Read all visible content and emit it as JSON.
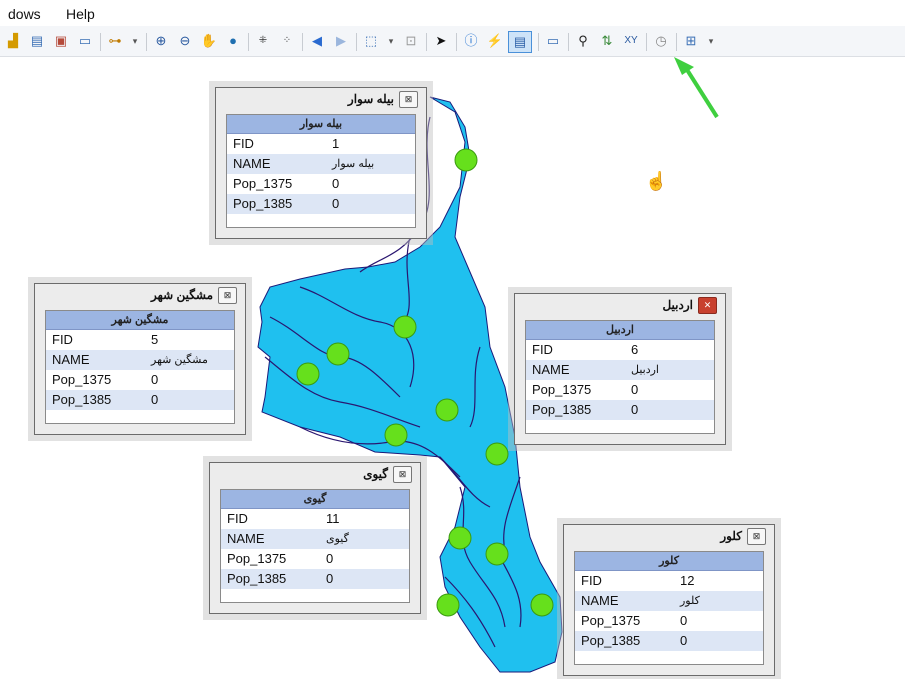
{
  "menu": {
    "windows": "dows",
    "help": "Help"
  },
  "toolbar": {
    "icons": [
      "globe-icon",
      "map-icon",
      "layer-icon",
      "window-icon",
      "fields-icon",
      "zoom-in-icon",
      "zoom-out-icon",
      "pan-icon",
      "full-extent-icon",
      "fixed-zoom-in-icon",
      "fixed-zoom-out-icon",
      "back-icon",
      "forward-icon",
      "select-features-icon",
      "clear-selection-icon",
      "select-elements-icon",
      "identify-icon",
      "hyperlink-icon",
      "html-popup-icon",
      "measure-icon",
      "find-icon",
      "find-route-icon",
      "goto-xy-icon",
      "time-slider-icon",
      "viewer-icon"
    ],
    "active": "html-popup-icon"
  },
  "popups": [
    {
      "id": "bileh-savar",
      "title": "بیله سوار",
      "header": "بیله سوار",
      "rows": [
        {
          "k": "FID",
          "v": "1"
        },
        {
          "k": "NAME",
          "v": "بیله سوار"
        },
        {
          "k": "Pop_1375",
          "v": "0"
        },
        {
          "k": "Pop_1385",
          "v": "0"
        }
      ]
    },
    {
      "id": "meshgin-shahr",
      "title": "مشگین شهر",
      "header": "مشگین شهر",
      "rows": [
        {
          "k": "FID",
          "v": "5"
        },
        {
          "k": "NAME",
          "v": "مشگین شهر"
        },
        {
          "k": "Pop_1375",
          "v": "0"
        },
        {
          "k": "Pop_1385",
          "v": "0"
        }
      ]
    },
    {
      "id": "ardabil",
      "title": "اردبیل",
      "header": "اردبیل",
      "rows": [
        {
          "k": "FID",
          "v": "6"
        },
        {
          "k": "NAME",
          "v": "اردبیل"
        },
        {
          "k": "Pop_1375",
          "v": "0"
        },
        {
          "k": "Pop_1385",
          "v": "0"
        }
      ]
    },
    {
      "id": "givi",
      "title": "گیوی",
      "header": "گیوی",
      "rows": [
        {
          "k": "FID",
          "v": "11"
        },
        {
          "k": "NAME",
          "v": "گیوی"
        },
        {
          "k": "Pop_1375",
          "v": "0"
        },
        {
          "k": "Pop_1385",
          "v": "0"
        }
      ]
    },
    {
      "id": "kolur",
      "title": "کلور",
      "header": "کلور",
      "rows": [
        {
          "k": "FID",
          "v": "12"
        },
        {
          "k": "NAME",
          "v": "کلور"
        },
        {
          "k": "Pop_1375",
          "v": "0"
        },
        {
          "k": "Pop_1385",
          "v": "0"
        }
      ]
    }
  ],
  "colors": {
    "map_fill": "#1fc0ef",
    "rivers": "#2a1670",
    "points": "#66e01c",
    "arrow": "#3fcf3f"
  }
}
